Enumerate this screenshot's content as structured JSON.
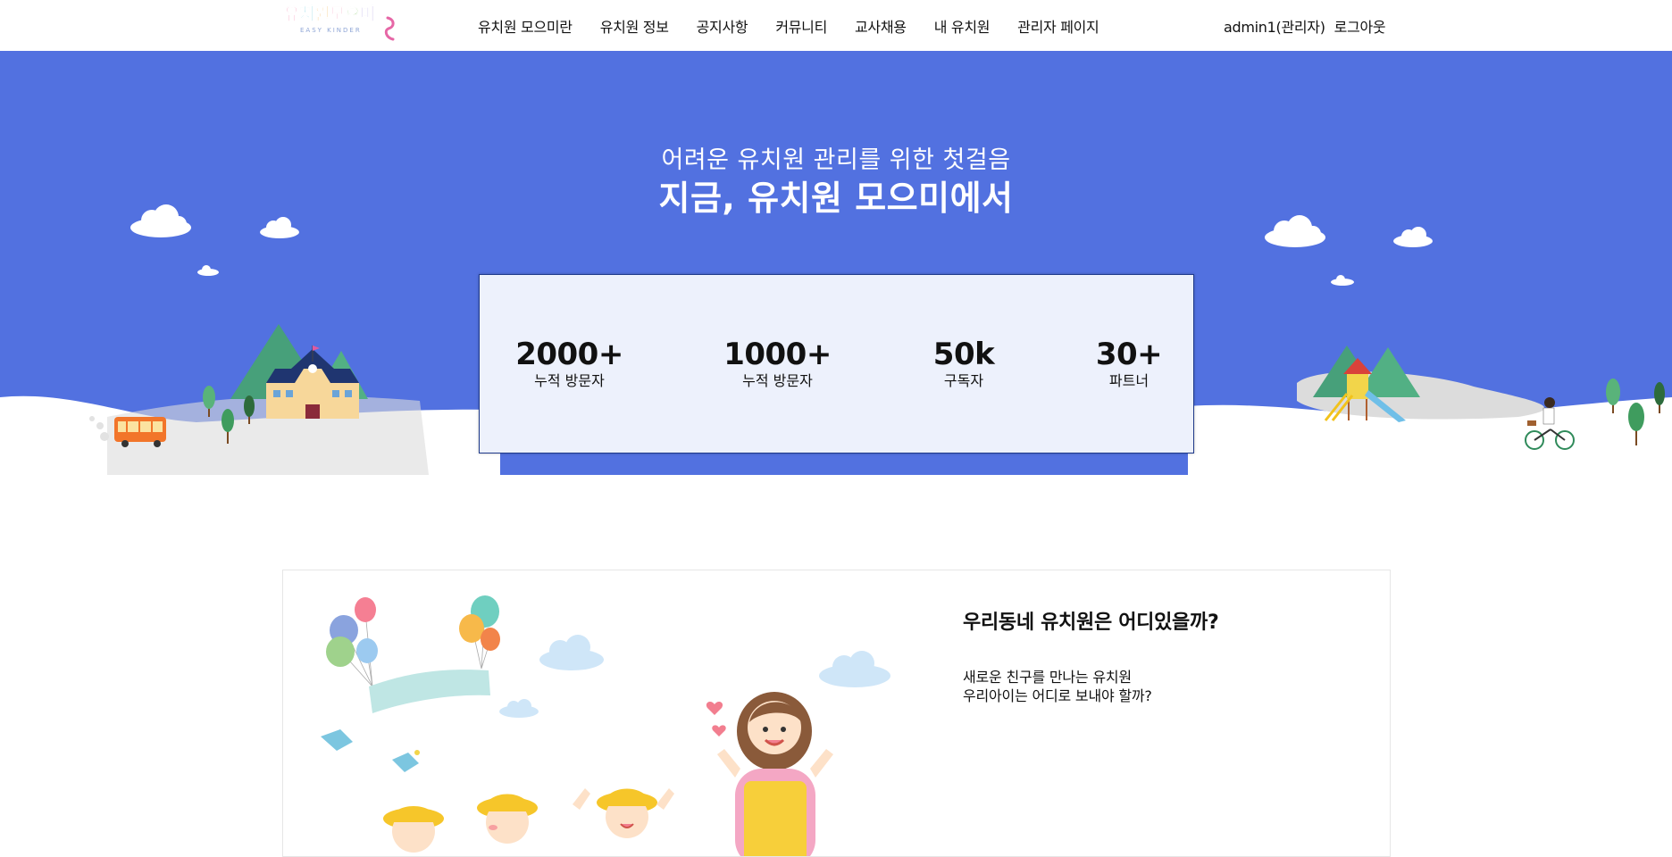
{
  "logo": {
    "text_chars": [
      "유",
      "치",
      "원",
      "모",
      "으",
      "미"
    ],
    "subtitle": "EASY KINDER",
    "colors": [
      "#f27ea9",
      "#7fd0e0",
      "#f5b947",
      "#8ac96b",
      "#f27ea9",
      "#9b86d9"
    ]
  },
  "nav": {
    "menu": [
      {
        "label": "유치원 모으미란"
      },
      {
        "label": "유치원 정보"
      },
      {
        "label": "공지사항"
      },
      {
        "label": "커뮤니티"
      },
      {
        "label": "교사채용"
      },
      {
        "label": "내 유치원"
      },
      {
        "label": "관리자 페이지"
      }
    ],
    "user_label": "admin1(관리자)",
    "logout_label": "로그아웃"
  },
  "hero": {
    "subtitle": "어려운 유치원 관리를 위한 첫걸음",
    "title": "지금, 유치원 모으미에서",
    "background_color": "#5271e0",
    "stats": [
      {
        "value": "2000+",
        "label": "누적 방문자"
      },
      {
        "value": "1000+",
        "label": "누적 방문자"
      },
      {
        "value": "50k",
        "label": "구독자"
      },
      {
        "value": "30+",
        "label": "파트너"
      }
    ]
  },
  "section": {
    "title": "우리동네 유치원은 어디있을까?",
    "lines": [
      "새로운 친구를 만나는 유치원",
      "우리아이는 어디로 보내야 할까?"
    ]
  }
}
